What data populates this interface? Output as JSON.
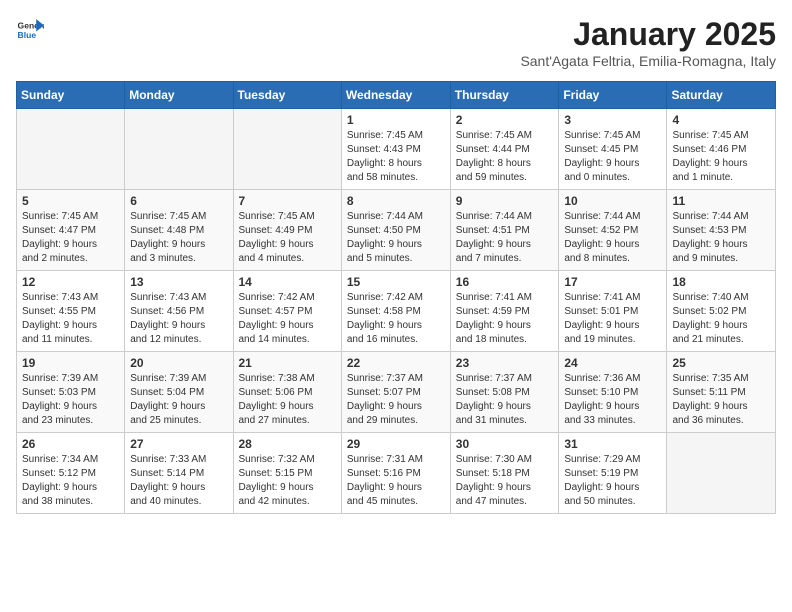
{
  "header": {
    "logo_general": "General",
    "logo_blue": "Blue",
    "month": "January 2025",
    "location": "Sant'Agata Feltria, Emilia-Romagna, Italy"
  },
  "weekdays": [
    "Sunday",
    "Monday",
    "Tuesday",
    "Wednesday",
    "Thursday",
    "Friday",
    "Saturday"
  ],
  "weeks": [
    [
      {
        "day": "",
        "info": ""
      },
      {
        "day": "",
        "info": ""
      },
      {
        "day": "",
        "info": ""
      },
      {
        "day": "1",
        "info": "Sunrise: 7:45 AM\nSunset: 4:43 PM\nDaylight: 8 hours\nand 58 minutes."
      },
      {
        "day": "2",
        "info": "Sunrise: 7:45 AM\nSunset: 4:44 PM\nDaylight: 8 hours\nand 59 minutes."
      },
      {
        "day": "3",
        "info": "Sunrise: 7:45 AM\nSunset: 4:45 PM\nDaylight: 9 hours\nand 0 minutes."
      },
      {
        "day": "4",
        "info": "Sunrise: 7:45 AM\nSunset: 4:46 PM\nDaylight: 9 hours\nand 1 minute."
      }
    ],
    [
      {
        "day": "5",
        "info": "Sunrise: 7:45 AM\nSunset: 4:47 PM\nDaylight: 9 hours\nand 2 minutes."
      },
      {
        "day": "6",
        "info": "Sunrise: 7:45 AM\nSunset: 4:48 PM\nDaylight: 9 hours\nand 3 minutes."
      },
      {
        "day": "7",
        "info": "Sunrise: 7:45 AM\nSunset: 4:49 PM\nDaylight: 9 hours\nand 4 minutes."
      },
      {
        "day": "8",
        "info": "Sunrise: 7:44 AM\nSunset: 4:50 PM\nDaylight: 9 hours\nand 5 minutes."
      },
      {
        "day": "9",
        "info": "Sunrise: 7:44 AM\nSunset: 4:51 PM\nDaylight: 9 hours\nand 7 minutes."
      },
      {
        "day": "10",
        "info": "Sunrise: 7:44 AM\nSunset: 4:52 PM\nDaylight: 9 hours\nand 8 minutes."
      },
      {
        "day": "11",
        "info": "Sunrise: 7:44 AM\nSunset: 4:53 PM\nDaylight: 9 hours\nand 9 minutes."
      }
    ],
    [
      {
        "day": "12",
        "info": "Sunrise: 7:43 AM\nSunset: 4:55 PM\nDaylight: 9 hours\nand 11 minutes."
      },
      {
        "day": "13",
        "info": "Sunrise: 7:43 AM\nSunset: 4:56 PM\nDaylight: 9 hours\nand 12 minutes."
      },
      {
        "day": "14",
        "info": "Sunrise: 7:42 AM\nSunset: 4:57 PM\nDaylight: 9 hours\nand 14 minutes."
      },
      {
        "day": "15",
        "info": "Sunrise: 7:42 AM\nSunset: 4:58 PM\nDaylight: 9 hours\nand 16 minutes."
      },
      {
        "day": "16",
        "info": "Sunrise: 7:41 AM\nSunset: 4:59 PM\nDaylight: 9 hours\nand 18 minutes."
      },
      {
        "day": "17",
        "info": "Sunrise: 7:41 AM\nSunset: 5:01 PM\nDaylight: 9 hours\nand 19 minutes."
      },
      {
        "day": "18",
        "info": "Sunrise: 7:40 AM\nSunset: 5:02 PM\nDaylight: 9 hours\nand 21 minutes."
      }
    ],
    [
      {
        "day": "19",
        "info": "Sunrise: 7:39 AM\nSunset: 5:03 PM\nDaylight: 9 hours\nand 23 minutes."
      },
      {
        "day": "20",
        "info": "Sunrise: 7:39 AM\nSunset: 5:04 PM\nDaylight: 9 hours\nand 25 minutes."
      },
      {
        "day": "21",
        "info": "Sunrise: 7:38 AM\nSunset: 5:06 PM\nDaylight: 9 hours\nand 27 minutes."
      },
      {
        "day": "22",
        "info": "Sunrise: 7:37 AM\nSunset: 5:07 PM\nDaylight: 9 hours\nand 29 minutes."
      },
      {
        "day": "23",
        "info": "Sunrise: 7:37 AM\nSunset: 5:08 PM\nDaylight: 9 hours\nand 31 minutes."
      },
      {
        "day": "24",
        "info": "Sunrise: 7:36 AM\nSunset: 5:10 PM\nDaylight: 9 hours\nand 33 minutes."
      },
      {
        "day": "25",
        "info": "Sunrise: 7:35 AM\nSunset: 5:11 PM\nDaylight: 9 hours\nand 36 minutes."
      }
    ],
    [
      {
        "day": "26",
        "info": "Sunrise: 7:34 AM\nSunset: 5:12 PM\nDaylight: 9 hours\nand 38 minutes."
      },
      {
        "day": "27",
        "info": "Sunrise: 7:33 AM\nSunset: 5:14 PM\nDaylight: 9 hours\nand 40 minutes."
      },
      {
        "day": "28",
        "info": "Sunrise: 7:32 AM\nSunset: 5:15 PM\nDaylight: 9 hours\nand 42 minutes."
      },
      {
        "day": "29",
        "info": "Sunrise: 7:31 AM\nSunset: 5:16 PM\nDaylight: 9 hours\nand 45 minutes."
      },
      {
        "day": "30",
        "info": "Sunrise: 7:30 AM\nSunset: 5:18 PM\nDaylight: 9 hours\nand 47 minutes."
      },
      {
        "day": "31",
        "info": "Sunrise: 7:29 AM\nSunset: 5:19 PM\nDaylight: 9 hours\nand 50 minutes."
      },
      {
        "day": "",
        "info": ""
      }
    ]
  ]
}
